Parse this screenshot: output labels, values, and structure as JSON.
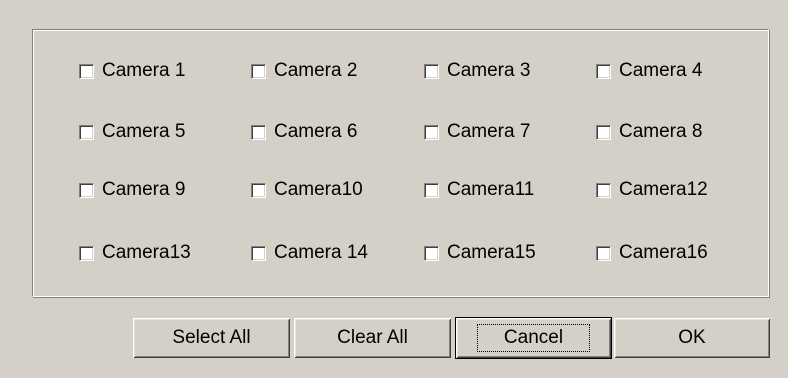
{
  "dialog": {
    "cameras": [
      {
        "label": "Camera 1",
        "checked": false
      },
      {
        "label": "Camera 2",
        "checked": false
      },
      {
        "label": "Camera 3",
        "checked": false
      },
      {
        "label": "Camera 4",
        "checked": false
      },
      {
        "label": "Camera 5",
        "checked": false
      },
      {
        "label": "Camera 6",
        "checked": false
      },
      {
        "label": "Camera 7",
        "checked": false
      },
      {
        "label": "Camera 8",
        "checked": false
      },
      {
        "label": "Camera 9",
        "checked": false
      },
      {
        "label": "Camera10",
        "checked": false
      },
      {
        "label": "Camera11",
        "checked": false
      },
      {
        "label": "Camera12",
        "checked": false
      },
      {
        "label": "Camera13",
        "checked": false
      },
      {
        "label": "Camera 14",
        "checked": false
      },
      {
        "label": "Camera15",
        "checked": false
      },
      {
        "label": "Camera16",
        "checked": false
      }
    ],
    "buttons": {
      "select_all": "Select All",
      "clear_all": "Clear All",
      "cancel": "Cancel",
      "ok": "OK"
    },
    "focused_button": "cancel"
  }
}
